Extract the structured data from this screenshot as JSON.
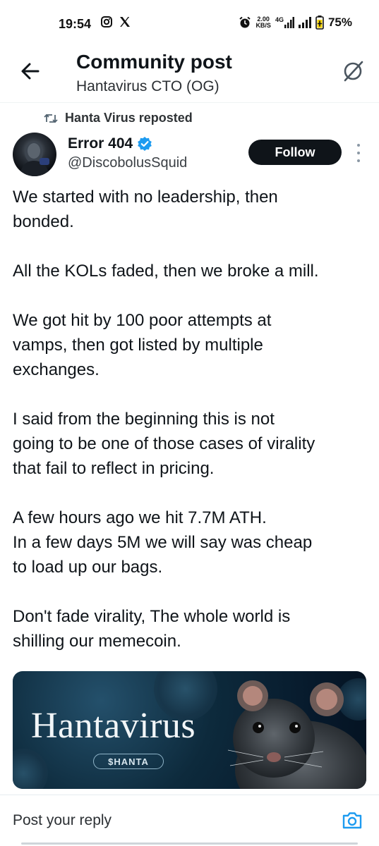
{
  "status_bar": {
    "time": "19:54",
    "speed_value": "2.00",
    "speed_unit": "KB/S",
    "network": "4G",
    "battery": "75%"
  },
  "header": {
    "title": "Community post",
    "subtitle": "Hantavirus CTO (OG)"
  },
  "repost": {
    "label": "Hanta Virus reposted"
  },
  "author": {
    "name": "Error 404",
    "handle": "@DiscobolusSquid",
    "verified": true,
    "follow_label": "Follow"
  },
  "post": {
    "paragraphs": [
      [
        "We started with no leadership, then",
        "bonded."
      ],
      [
        "All the KOLs faded, then we broke a mill."
      ],
      [
        "We got hit by 100 poor attempts at",
        "vamps, then got listed by multiple",
        "exchanges."
      ],
      [
        "I said from the beginning this is not",
        "going to be one of those cases of virality",
        "that fail to reflect in pricing."
      ],
      [
        "A few hours ago we hit 7.7M ATH.",
        "In a few days 5M we will say was cheap",
        "to load up our bags."
      ],
      [
        "Don't fade virality, The whole world is",
        "shilling our memecoin."
      ]
    ]
  },
  "media": {
    "title": "Hantavirus",
    "ticker": "$HANTA"
  },
  "reply": {
    "placeholder": "Post your reply"
  },
  "colors": {
    "follow_bg": "#0f1419",
    "verified": "#1d9bf0",
    "camera": "#1d9bf0"
  }
}
